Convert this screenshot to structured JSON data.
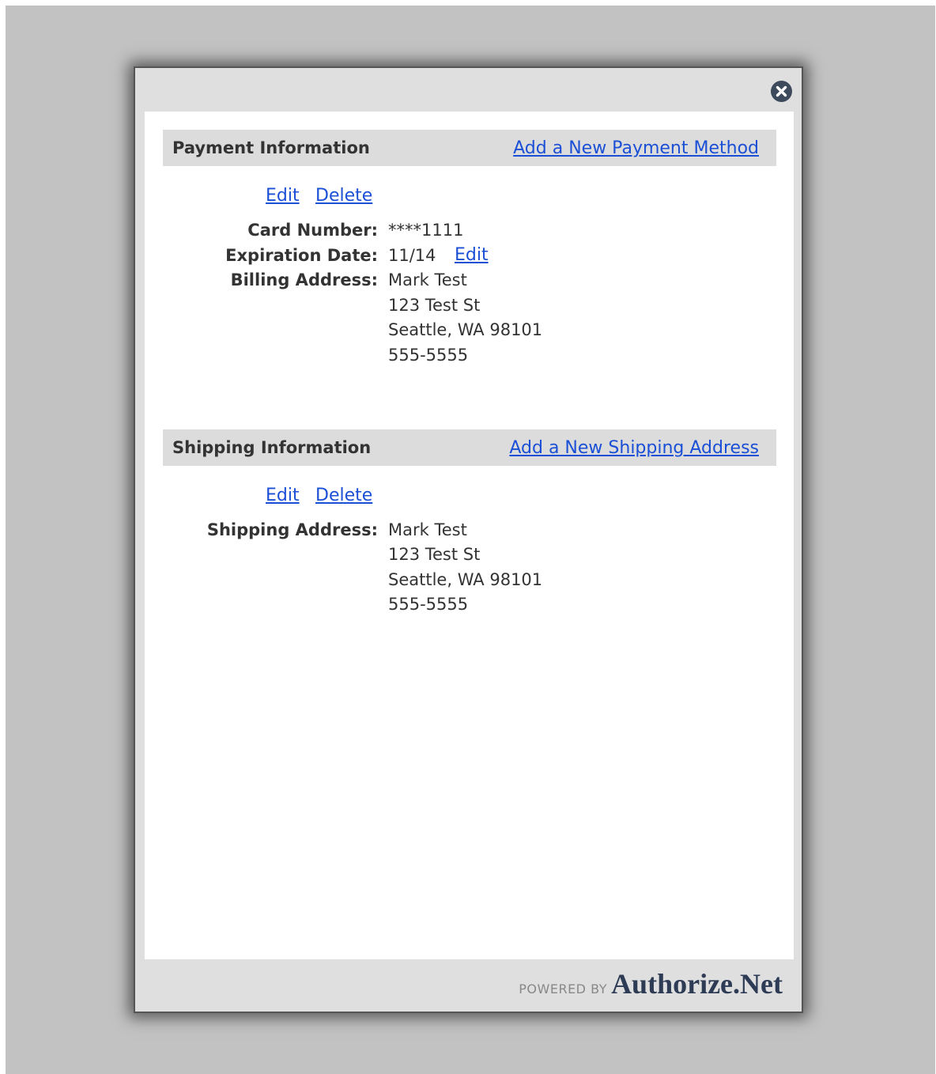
{
  "dialog": {
    "close_icon": "close-icon"
  },
  "payment": {
    "title": "Payment Information",
    "add_link": "Add a New Payment Method",
    "edit_label": "Edit",
    "delete_label": "Delete",
    "card_number_label": "Card Number:",
    "card_number_value": "****1111",
    "expiration_label": "Expiration Date:",
    "expiration_value": "11/14",
    "expiration_edit_label": "Edit",
    "billing_label": "Billing Address:",
    "billing_lines": [
      "Mark Test",
      "123 Test St",
      "Seattle, WA 98101",
      "555-5555"
    ]
  },
  "shipping": {
    "title": "Shipping Information",
    "add_link": "Add a New Shipping Address",
    "edit_label": "Edit",
    "delete_label": "Delete",
    "address_label": "Shipping Address:",
    "address_lines": [
      "Mark Test",
      "123 Test St",
      "Seattle, WA 98101",
      "555-5555"
    ]
  },
  "footer": {
    "powered_by": "POWERED BY",
    "brand": "Authorize.Net"
  },
  "colors": {
    "link": "#1a4fd6",
    "header_bg": "#dcdcdc",
    "backdrop": "#c2c2c2"
  }
}
